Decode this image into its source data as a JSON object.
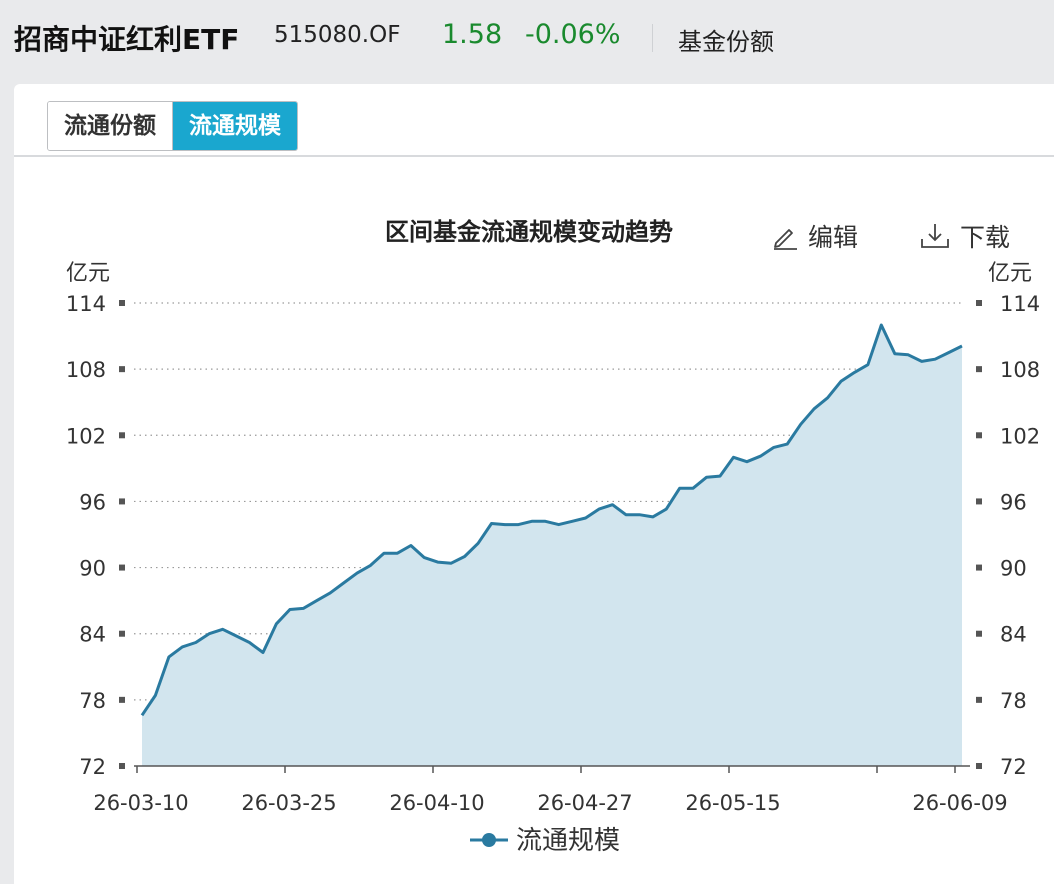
{
  "header": {
    "fund_name": "招商中证红利ETF",
    "fund_code": "515080.OF",
    "price": "1.58",
    "change": "-0.06%",
    "tab": "基金份额"
  },
  "toggle": {
    "shares_label": "流通份额",
    "scale_label": "流通规模",
    "active": "流通规模"
  },
  "toolbar": {
    "edit_label": "编辑",
    "download_label": "下载"
  },
  "colors": {
    "accent": "#1aa7cf",
    "up_down": "#1a8a2e",
    "line": "#2a7aa0",
    "area": "#d2e5ee"
  },
  "chart_data": {
    "type": "area",
    "title": "区间基金流通规模变动趋势",
    "unit_left": "亿元",
    "unit_right": "亿元",
    "ylim": [
      72,
      114
    ],
    "yticks": [
      72,
      78,
      84,
      90,
      96,
      102,
      108,
      114
    ],
    "xtick_labels": [
      "26-03-10",
      "26-03-25",
      "26-04-10",
      "26-04-27",
      "26-05-15",
      "26-06-09"
    ],
    "grid": true,
    "legend": "bottom",
    "series": [
      {
        "name": "流通规模",
        "values": [
          76.6,
          78.4,
          81.9,
          82.8,
          83.2,
          84.0,
          84.4,
          83.8,
          83.2,
          82.3,
          84.9,
          86.2,
          86.3,
          87.0,
          87.7,
          88.6,
          89.5,
          90.2,
          91.3,
          91.3,
          92.0,
          90.9,
          90.5,
          90.4,
          91.0,
          92.2,
          94.0,
          93.9,
          93.9,
          94.2,
          94.2,
          93.9,
          94.2,
          94.5,
          95.3,
          95.7,
          94.8,
          94.8,
          94.6,
          95.3,
          97.2,
          97.2,
          98.2,
          98.3,
          100.0,
          99.6,
          100.1,
          100.9,
          101.2,
          103.0,
          104.4,
          105.4,
          106.9,
          107.7,
          108.4,
          112.0,
          109.4,
          109.3,
          108.7,
          108.9,
          109.5,
          110.1
        ]
      }
    ]
  }
}
